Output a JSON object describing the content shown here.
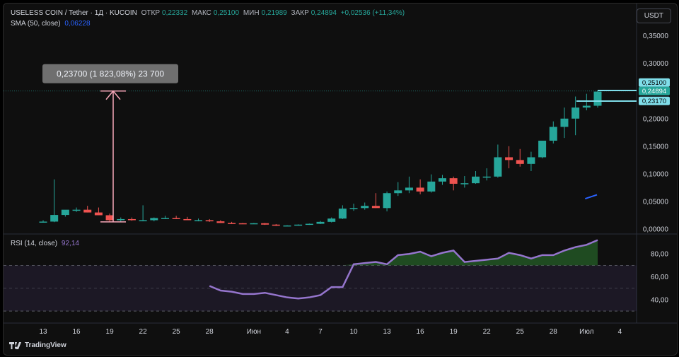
{
  "header": {
    "symbol": "USELESS COIN / Tether · 1Д · KUCOIN",
    "open_label": "ОТКР",
    "open": "0,22332",
    "high_label": "МАКС",
    "high": "0,25100",
    "low_label": "МИН",
    "low": "0,21989",
    "close_label": "ЗАКР",
    "close": "0,24894",
    "change": "+0,02536 (+11,34%)",
    "sma_label": "SMA (50, close)",
    "sma_value": "0,06228"
  },
  "currency_button": "USDT",
  "rsi_label": "RSI (14, close)",
  "rsi_value": "92,14",
  "measure_label": "0,23700 (1 823,08%) 23 700",
  "brand": "TradingView",
  "price_tags": {
    "high": "0,25100",
    "close": "0,24894",
    "low": "0,23170"
  },
  "colors": {
    "up": "#26a69a",
    "down": "#ef5350",
    "rsi": "#9575cd",
    "sma": "#2962ff",
    "measure": "#f7a7b9",
    "tag": "#80deea"
  },
  "chart_data": [
    {
      "type": "candlestick",
      "x": [
        "13",
        "14",
        "15",
        "16",
        "17",
        "18",
        "19",
        "20",
        "21",
        "22",
        "23",
        "24",
        "25",
        "26",
        "27",
        "28",
        "29",
        "30",
        "31",
        "Июн",
        "2",
        "3",
        "4",
        "5",
        "6",
        "7",
        "8",
        "9",
        "10",
        "11",
        "12",
        "13",
        "14",
        "15",
        "16",
        "17",
        "18",
        "19",
        "20",
        "21",
        "22",
        "23",
        "24",
        "25",
        "26",
        "27",
        "28",
        "29",
        "30",
        "Июл",
        "2"
      ],
      "open": [
        0.0125,
        0.0135,
        0.0255,
        0.035,
        0.035,
        0.03,
        0.025,
        0.016,
        0.018,
        0.016,
        0.016,
        0.02,
        0.02,
        0.018,
        0.016,
        0.016,
        0.014,
        0.011,
        0.0105,
        0.01,
        0.0105,
        0.008,
        0.006,
        0.0065,
        0.008,
        0.0095,
        0.013,
        0.019,
        0.037,
        0.038,
        0.042,
        0.038,
        0.065,
        0.07,
        0.075,
        0.068,
        0.086,
        0.092,
        0.082,
        0.083,
        0.095,
        0.095,
        0.13,
        0.125,
        0.118,
        0.13,
        0.16,
        0.185,
        0.2,
        0.22,
        0.22332
      ],
      "high": [
        0.016,
        0.09,
        0.029,
        0.039,
        0.042,
        0.039,
        0.028,
        0.021,
        0.021,
        0.043,
        0.021,
        0.024,
        0.024,
        0.022,
        0.019,
        0.018,
        0.016,
        0.013,
        0.011,
        0.011,
        0.011,
        0.009,
        0.007,
        0.0085,
        0.01,
        0.0145,
        0.021,
        0.043,
        0.046,
        0.048,
        0.065,
        0.068,
        0.085,
        0.095,
        0.09,
        0.099,
        0.098,
        0.095,
        0.096,
        0.105,
        0.11,
        0.153,
        0.15,
        0.145,
        0.14,
        0.16,
        0.195,
        0.22,
        0.24,
        0.245,
        0.251
      ],
      "low": [
        0.0115,
        0.0125,
        0.0225,
        0.031,
        0.03,
        0.025,
        0.013,
        0.013,
        0.015,
        0.014,
        0.014,
        0.018,
        0.018,
        0.016,
        0.014,
        0.013,
        0.011,
        0.0095,
        0.009,
        0.009,
        0.0075,
        0.0055,
        0.0055,
        0.006,
        0.0075,
        0.009,
        0.012,
        0.018,
        0.033,
        0.035,
        0.038,
        0.032,
        0.06,
        0.065,
        0.063,
        0.066,
        0.08,
        0.07,
        0.075,
        0.082,
        0.088,
        0.093,
        0.11,
        0.113,
        0.105,
        0.128,
        0.155,
        0.165,
        0.17,
        0.215,
        0.21989
      ],
      "close": [
        0.0135,
        0.0255,
        0.035,
        0.035,
        0.03,
        0.025,
        0.016,
        0.018,
        0.016,
        0.016,
        0.02,
        0.02,
        0.018,
        0.016,
        0.016,
        0.014,
        0.011,
        0.0105,
        0.01,
        0.0105,
        0.008,
        0.006,
        0.0065,
        0.008,
        0.0095,
        0.013,
        0.019,
        0.037,
        0.038,
        0.042,
        0.038,
        0.065,
        0.07,
        0.075,
        0.068,
        0.086,
        0.092,
        0.082,
        0.083,
        0.095,
        0.095,
        0.13,
        0.125,
        0.118,
        0.13,
        0.16,
        0.185,
        0.2,
        0.22,
        0.22332,
        0.24894
      ],
      "sma_segment": [
        0.055,
        0.062
      ],
      "ylim": [
        0,
        0.37
      ],
      "y_ticks": [
        "0,00000",
        "0,05000",
        "0,10000",
        "0,15000",
        "0,20000",
        "0,25000",
        "0,30000",
        "0,35000"
      ],
      "y_tick_values": [
        0,
        0.05,
        0.1,
        0.15,
        0.2,
        0.25,
        0.3,
        0.35
      ],
      "measure": {
        "from": 0.013,
        "to": 0.25
      }
    },
    {
      "type": "line",
      "name": "RSI (14, close)",
      "x": [
        "28",
        "29",
        "30",
        "31",
        "Июн",
        "2",
        "3",
        "4",
        "5",
        "6",
        "7",
        "8",
        "9",
        "10",
        "11",
        "12",
        "13",
        "14",
        "15",
        "16",
        "17",
        "18",
        "19",
        "20",
        "21",
        "22",
        "23",
        "24",
        "25",
        "26",
        "27",
        "28",
        "29",
        "30",
        "Июл",
        "2"
      ],
      "values": [
        52,
        48,
        47,
        45,
        45,
        46,
        44,
        42,
        41,
        42,
        44,
        51,
        51,
        71,
        72,
        73,
        71,
        79,
        80,
        82,
        78,
        81,
        83,
        73,
        74,
        75,
        76,
        81,
        79,
        76,
        79,
        79,
        83,
        86,
        88,
        92.14
      ],
      "ylim": [
        22,
        95
      ],
      "y_ticks": [
        "40,00",
        "60,00",
        "80,00"
      ],
      "y_tick_values": [
        40,
        60,
        80
      ],
      "bands": [
        30,
        50,
        70
      ]
    }
  ],
  "x_tick_labels": [
    "13",
    "16",
    "19",
    "22",
    "25",
    "28",
    "Июн",
    "4",
    "7",
    "10",
    "13",
    "16",
    "19",
    "22",
    "25",
    "28",
    "Июл",
    "4"
  ]
}
